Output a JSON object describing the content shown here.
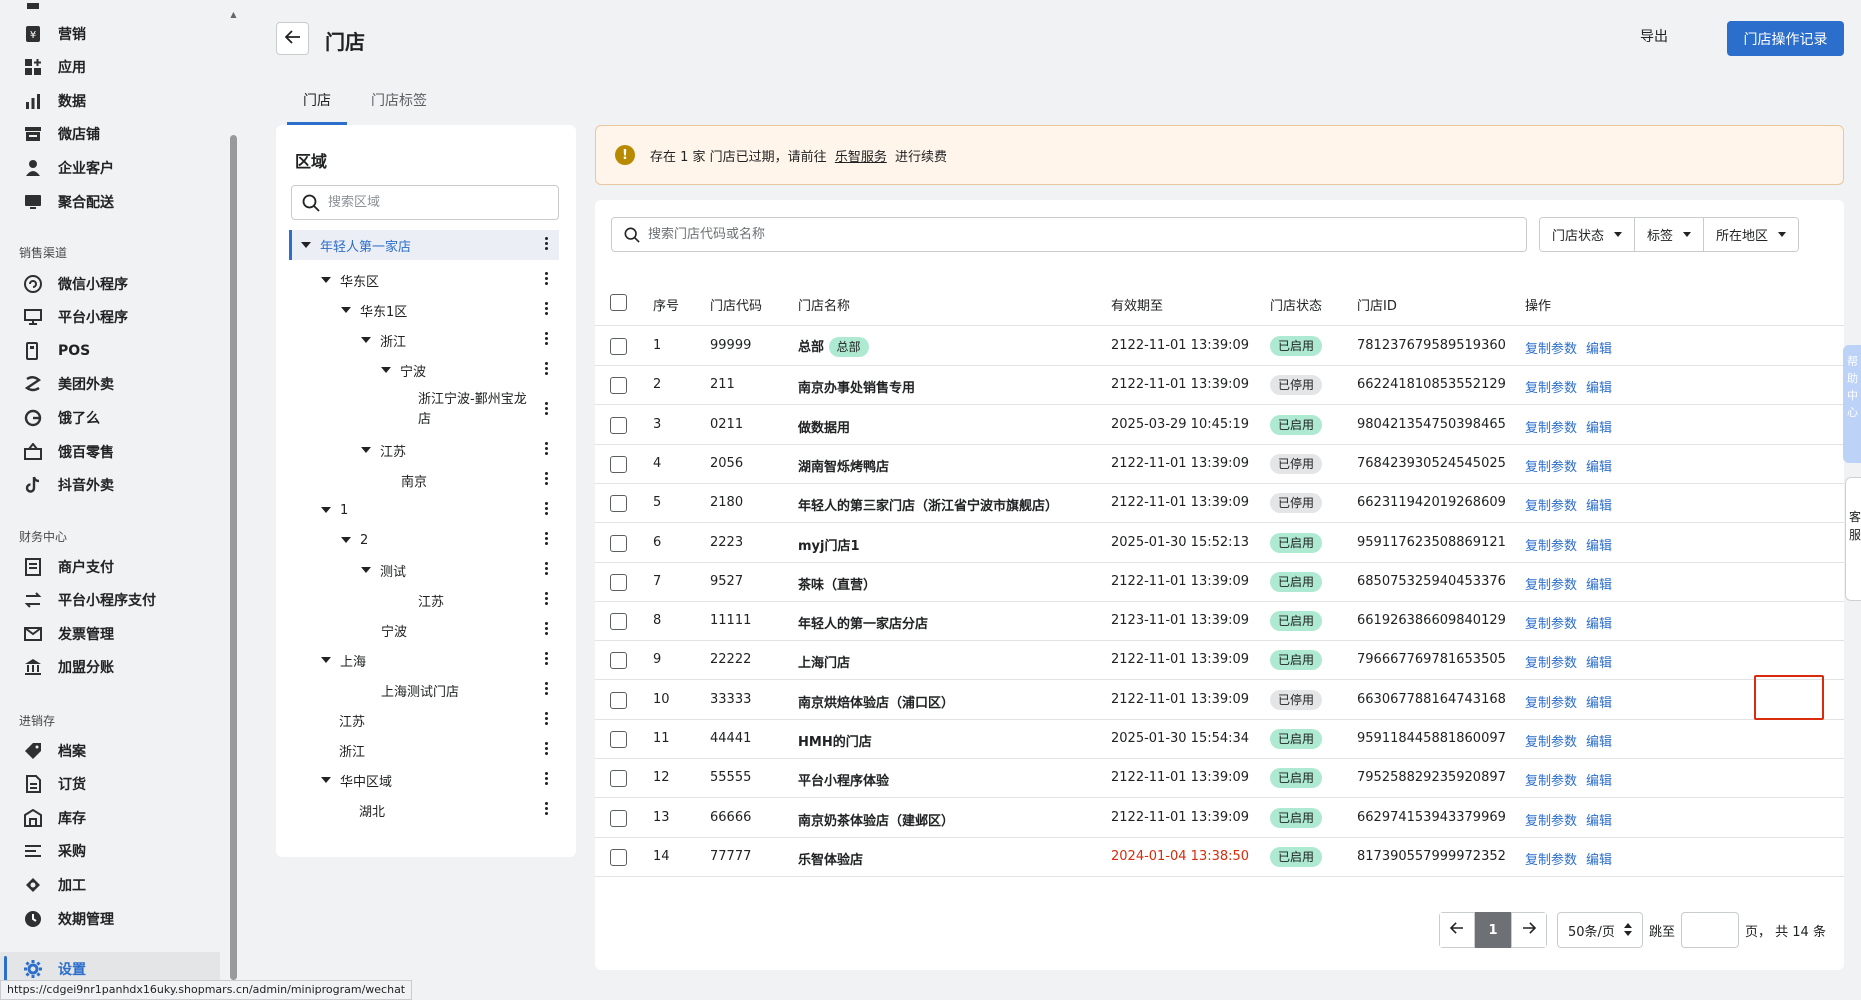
{
  "sidebar": {
    "items_top": [
      {
        "label": "营销",
        "icon": "yen-icon"
      },
      {
        "label": "应用",
        "icon": "apps-icon"
      },
      {
        "label": "数据",
        "icon": "bar-chart-icon"
      },
      {
        "label": "微店铺",
        "icon": "store-icon"
      },
      {
        "label": "企业客户",
        "icon": "person-icon"
      },
      {
        "label": "聚合配送",
        "icon": "monitor-icon"
      }
    ],
    "sales_section": "销售渠道",
    "sales_items": [
      {
        "label": "微信小程序",
        "icon": "wechat-icon"
      },
      {
        "label": "平台小程序",
        "icon": "screen-icon"
      },
      {
        "label": "POS",
        "icon": "pos-icon"
      },
      {
        "label": "美团外卖",
        "icon": "meituan-icon"
      },
      {
        "label": "饿了么",
        "icon": "eleme-icon"
      },
      {
        "label": "饿百零售",
        "icon": "basket-icon"
      },
      {
        "label": "抖音外卖",
        "icon": "douyin-icon"
      }
    ],
    "finance_section": "财务中心",
    "finance_items": [
      {
        "label": "商户支付",
        "icon": "receipt-icon"
      },
      {
        "label": "平台小程序支付",
        "icon": "transfer-icon"
      },
      {
        "label": "发票管理",
        "icon": "invoice-icon"
      },
      {
        "label": "加盟分账",
        "icon": "bank-icon"
      }
    ],
    "inventory_section": "进销存",
    "inventory_items": [
      {
        "label": "档案",
        "icon": "tag-icon"
      },
      {
        "label": "订货",
        "icon": "document-icon"
      },
      {
        "label": "库存",
        "icon": "warehouse-icon"
      },
      {
        "label": "采购",
        "icon": "list-icon"
      },
      {
        "label": "加工",
        "icon": "process-icon"
      },
      {
        "label": "效期管理",
        "icon": "clock-icon"
      }
    ],
    "settings": {
      "label": "设置",
      "icon": "gear-icon"
    }
  },
  "status_url": "https://cdgei9nr1panhdx16uky.shopmars.cn/admin/miniprogram/wechat",
  "header": {
    "title": "门店",
    "export_label": "导出",
    "log_label": "门店操作记录"
  },
  "tabs": [
    "门店",
    "门店标签"
  ],
  "region": {
    "title": "区域",
    "search_placeholder": "搜索区域",
    "tree": [
      {
        "label": "年轻人第一家店",
        "selected": true
      },
      {
        "label": "华东区"
      },
      {
        "label": "华东1区"
      },
      {
        "label": "浙江"
      },
      {
        "label": "宁波"
      },
      {
        "label": "浙江宁波-鄞州宝龙店"
      },
      {
        "label": "江苏"
      },
      {
        "label": "南京"
      },
      {
        "label": "1"
      },
      {
        "label": "2"
      },
      {
        "label": "测试"
      },
      {
        "label": "江苏"
      },
      {
        "label": "宁波"
      },
      {
        "label": "上海"
      },
      {
        "label": "上海测试门店"
      },
      {
        "label": "江苏"
      },
      {
        "label": "浙江"
      },
      {
        "label": "华中区域"
      },
      {
        "label": "湖北"
      }
    ]
  },
  "banner": {
    "prefix": "存在 1 家 门店已过期，请前往",
    "link": "乐智服务",
    "suffix": "进行续费"
  },
  "stores": {
    "search_placeholder": "搜索门店代码或名称",
    "filters": [
      "门店状态",
      "标签",
      "所在地区"
    ],
    "columns": [
      "序号",
      "门店代码",
      "门店名称",
      "有效期至",
      "门店状态",
      "门店ID",
      "操作"
    ],
    "copy_label": "复制参数",
    "edit_label": "编辑",
    "rows": [
      {
        "no": "1",
        "code": "99999",
        "name": "总部",
        "tag": "总部",
        "expiry": "2122-11-01 13:39:09",
        "status": "已启用",
        "active": true,
        "id": "781237679589519360"
      },
      {
        "no": "2",
        "code": "211",
        "name": "南京办事处销售专用",
        "expiry": "2122-11-01 13:39:09",
        "status": "已停用",
        "active": false,
        "id": "662241810853552129"
      },
      {
        "no": "3",
        "code": "0211",
        "name": "做数据用",
        "expiry": "2025-03-29 10:45:19",
        "status": "已启用",
        "active": true,
        "id": "980421354750398465"
      },
      {
        "no": "4",
        "code": "2056",
        "name": "湖南智烁烤鸭店",
        "expiry": "2122-11-01 13:39:09",
        "status": "已停用",
        "active": false,
        "id": "768423930524545025"
      },
      {
        "no": "5",
        "code": "2180",
        "name": "年轻人的第三家门店（浙江省宁波市旗舰店）",
        "expiry": "2122-11-01 13:39:09",
        "status": "已停用",
        "active": false,
        "id": "662311942019268609"
      },
      {
        "no": "6",
        "code": "2223",
        "name": "myj门店1",
        "expiry": "2025-01-30 15:52:13",
        "status": "已启用",
        "active": true,
        "id": "959117623508869121"
      },
      {
        "no": "7",
        "code": "9527",
        "name": "茶味（直营）",
        "expiry": "2122-11-01 13:39:09",
        "status": "已启用",
        "active": true,
        "id": "685075325940453376"
      },
      {
        "no": "8",
        "code": "11111",
        "name": "年轻人的第一家店分店",
        "expiry": "2123-11-01 13:39:09",
        "status": "已启用",
        "active": true,
        "id": "661926386609840129"
      },
      {
        "no": "9",
        "code": "22222",
        "name": "上海门店",
        "expiry": "2122-11-01 13:39:09",
        "status": "已启用",
        "active": true,
        "id": "796667769781653505"
      },
      {
        "no": "10",
        "code": "33333",
        "name": "南京烘焙体验店（浦口区）",
        "expiry": "2122-11-01 13:39:09",
        "status": "已停用",
        "active": false,
        "id": "663067788164743168"
      },
      {
        "no": "11",
        "code": "44441",
        "name": "HMH的门店",
        "expiry": "2025-01-30 15:54:34",
        "status": "已启用",
        "active": true,
        "id": "959118445881860097"
      },
      {
        "no": "12",
        "code": "55555",
        "name": "平台小程序体验",
        "expiry": "2122-11-01 13:39:09",
        "status": "已启用",
        "active": true,
        "id": "795258829235920897"
      },
      {
        "no": "13",
        "code": "66666",
        "name": "南京奶茶体验店（建邺区）",
        "expiry": "2122-11-01 13:39:09",
        "status": "已启用",
        "active": true,
        "id": "662974153943379969"
      },
      {
        "no": "14",
        "code": "77777",
        "name": "乐智体验店",
        "expiry": "2024-01-04 13:38:50",
        "expired": true,
        "status": "已启用",
        "active": true,
        "id": "817390557999972352"
      }
    ]
  },
  "pagination": {
    "current": "1",
    "page_size": "50条/页",
    "jump_label": "跳至",
    "total": "页， 共 14 条"
  },
  "float": {
    "tab_text": "帮助中心",
    "help_text": "客服"
  },
  "colors": {
    "primary": "#2c6ecb",
    "enabled_badge": "#aee9d1",
    "disabled_badge": "#e4e5e7",
    "expired_text": "#d82c0d",
    "banner_bg": "#fff5ea"
  }
}
